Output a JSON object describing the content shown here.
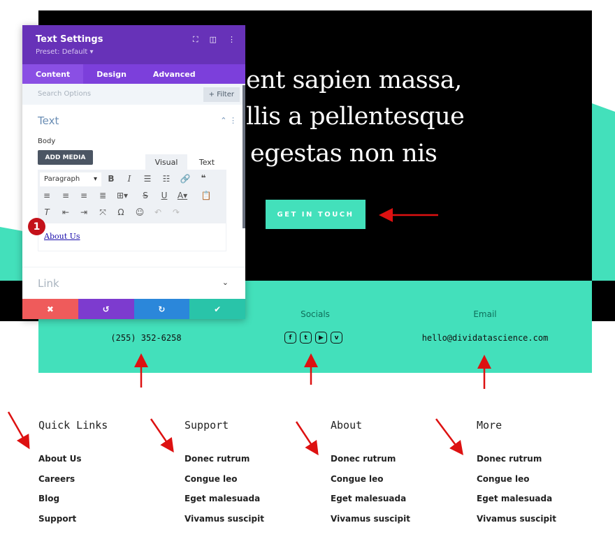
{
  "hero": {
    "lines": [
      "ent sapien massa,",
      "llis a pellentesque",
      "egestas non nis"
    ],
    "cta": "GET IN TOUCH"
  },
  "contact": {
    "phone": "(255) 352-6258",
    "socials_label": "Socials",
    "socials": [
      "facebook-icon",
      "twitter-icon",
      "youtube-icon",
      "vimeo-icon"
    ],
    "email_label": "Email",
    "email": "hello@dividatascience.com"
  },
  "footer": {
    "columns": [
      {
        "title": "Quick Links",
        "links": [
          "About Us",
          "Careers",
          "Blog",
          "Support"
        ]
      },
      {
        "title": "Support",
        "links": [
          "Donec rutrum",
          "Congue leo",
          "Eget malesuada",
          "Vivamus suscipit"
        ]
      },
      {
        "title": "About",
        "links": [
          "Donec rutrum",
          "Congue leo",
          "Eget malesuada",
          "Vivamus suscipit"
        ]
      },
      {
        "title": "More",
        "links": [
          "Donec rutrum",
          "Congue leo",
          "Eget malesuada",
          "Vivamus suscipit"
        ]
      }
    ]
  },
  "panel": {
    "title": "Text Settings",
    "preset": "Preset: Default ▾",
    "tabs": [
      "Content",
      "Design",
      "Advanced"
    ],
    "active_tab": "Content",
    "search_placeholder": "Search Options",
    "filter": "+ Filter",
    "section_text": "Text",
    "body_label": "Body",
    "add_media": "ADD MEDIA",
    "visual_tab": "Visual",
    "text_tab": "Text",
    "format_select": "Paragraph",
    "editor_content": "About Us",
    "section_link": "Link",
    "badge": "1"
  },
  "colors": {
    "accent": "#43e0bb",
    "panel_header": "#6732b8",
    "cancel": "#ef5b5b",
    "undo": "#7d3bcf",
    "redo": "#2b87da",
    "save": "#29c4a9",
    "arrow": "#dd1111"
  }
}
